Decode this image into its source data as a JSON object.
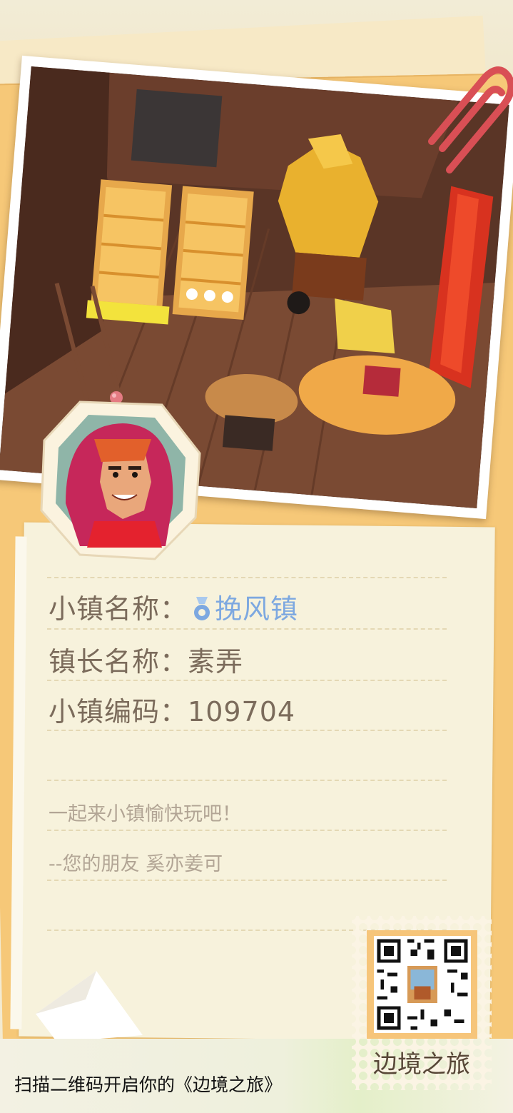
{
  "info": {
    "town_name_label": "小镇名称：",
    "town_name_value": "挽风镇",
    "mayor_label": "镇长名称：",
    "mayor_value": "素弄",
    "code_label": "小镇编码：",
    "code_value": "109704",
    "message": "一起来小镇愉快玩吧！",
    "signature": "--您的朋友  奚亦姜可"
  },
  "footer": {
    "scan_text": "扫描二维码开启你的《边境之旅》"
  },
  "stamp": {
    "label": "边境之旅"
  },
  "icons": {
    "location": "location-pin-icon",
    "avatar": "avatar-portrait",
    "qr": "qr-code"
  },
  "colors": {
    "folder": "#f6c878",
    "paper": "#f7f2dc",
    "label_text": "#7b6b5b",
    "town_name": "#7da8e0",
    "message_text": "#b2a595"
  }
}
